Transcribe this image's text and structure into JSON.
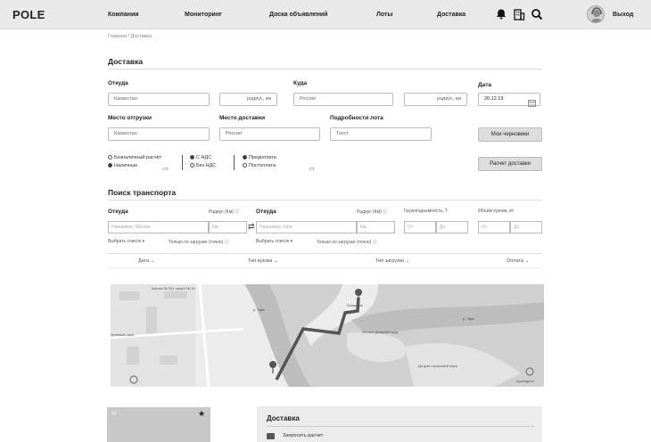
{
  "header": {
    "logo": "POLE",
    "nav": [
      "Компании",
      "Мониторинг",
      "Доска объявлений",
      "Лоты",
      "Доставка"
    ],
    "icons": [
      "bell-icon",
      "building-icon",
      "search-icon"
    ],
    "logout": "Выход"
  },
  "breadcrumb": "Главная / Доставка",
  "delivery": {
    "title": "Доставка",
    "from_label": "Откуда",
    "from_value": "Казахстан",
    "from_radius_placeholder": "радиус, км",
    "to_label": "Куда",
    "to_value": "Россия",
    "to_radius_placeholder": "радиус, км",
    "date_label": "Дата",
    "date_value": "20.12.19",
    "ship_place_label": "Место отгрузки",
    "ship_place_value": "Казахстан",
    "deliv_place_label": "Место доставки",
    "deliv_place_value": "Россия",
    "lot_details_label": "Подробности лота",
    "lot_details_placeholder": "Текст",
    "drafts_button": "Мои черновики",
    "calc_button": "Расчет доставки",
    "payment": [
      "Безналичный расчёт",
      "Наличные"
    ],
    "vat": [
      "С НДС",
      "Без НДС"
    ],
    "terms": [
      "Предоплата",
      "Постоплата"
    ]
  },
  "transport": {
    "title": "Поиск транспорта",
    "from_label": "Откуда",
    "from_radius": "Радиус (Км)",
    "from_placeholder": "Например, Москва",
    "from_km": "Км",
    "to_label": "Откуда",
    "to_radius": "Радиус (Км)",
    "to_placeholder": "Например, Уфа",
    "to_km": "Км",
    "capacity_label": "Грузоподъемность, Т",
    "volume_label": "Объём кузова, м³",
    "from_ph": "От",
    "to_ph": "До",
    "select_list": "Выбрать список",
    "load_only": "Только по загрузке (точно)",
    "columns": [
      "Дата",
      "Тип кузова",
      "Тип загрузки",
      "Оплата"
    ]
  },
  "map": {
    "labels": [
      "Школа № 301 лицей № 18",
      "р. Уфа",
      "р. Уфа",
      "Зеленый парк",
      "Лесной Демской пруд",
      "Дя дем ограшский парк",
      "Аргандеса",
      "Базарова"
    ]
  },
  "card": {
    "letter": "М"
  },
  "panel": {
    "title": "Доставка",
    "item": "Запросить расчет"
  }
}
